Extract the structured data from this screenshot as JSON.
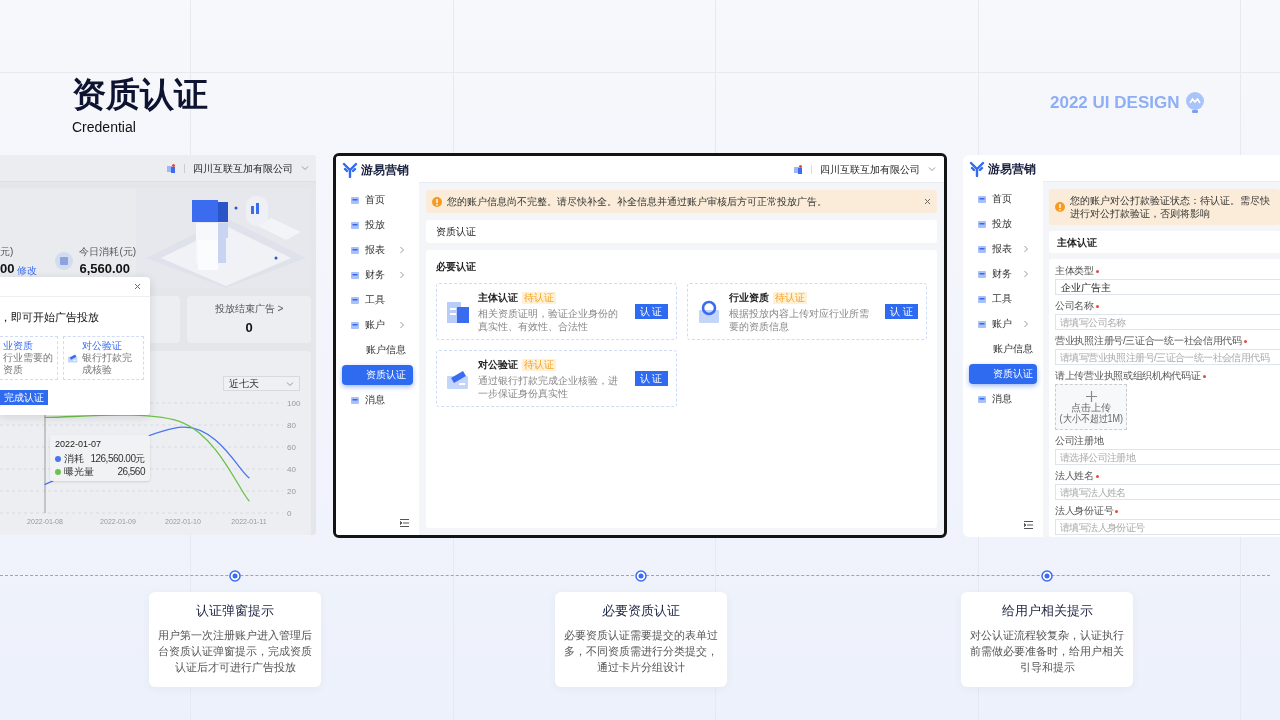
{
  "header": {
    "title": "资质认证",
    "subtitle": "Credential",
    "brand": "2022 UI DESIGN"
  },
  "left_panel": {
    "company": "四川互联互加有限公司",
    "balance_partial": {
      "label": "元)",
      "value": "00",
      "link": "修改"
    },
    "spend": {
      "label": "今日消耗(元)",
      "value": "6,560.00"
    },
    "summary_card": {
      "label": "投放结束广告 >",
      "value": "0"
    },
    "dialog": {
      "heading": "，即可开始广告投放",
      "button": "完成认证",
      "cards": [
        {
          "title": "业资质",
          "desc": "行业需要的资质"
        },
        {
          "kind": "bank",
          "title": "对公验证",
          "desc": "银行打款完成核验"
        }
      ]
    },
    "range_select": "近七天",
    "chart_data": {
      "type": "line",
      "grid": true,
      "ref_lines": [
        {
          "axis": "x",
          "value": "2022-01-08"
        }
      ],
      "categories": [
        "2022-01-08",
        "2022-01-09",
        "2022-01-10",
        "2022-01-11"
      ],
      "yticks": [
        0,
        20,
        40,
        60,
        80,
        100
      ],
      "ylim": [
        0,
        100
      ],
      "series": [
        {
          "name": "消耗",
          "color": "#4a74f0",
          "values": [
            26,
            null,
            78,
            32
          ]
        },
        {
          "name": "曝光量",
          "color": "#6cc24a",
          "values": [
            87,
            null,
            82,
            11
          ]
        }
      ]
    },
    "tooltip": {
      "date": "2022-01-07",
      "values": [
        "126,560.00元",
        "26,560"
      ]
    }
  },
  "center_panel": {
    "logo": "游易营销",
    "company": "四川互联互加有限公司",
    "nav": [
      {
        "label": "首页",
        "selected": false,
        "chevron": false
      },
      {
        "label": "投放",
        "selected": false,
        "chevron": false
      },
      {
        "label": "报表",
        "selected": false,
        "chevron": true
      },
      {
        "label": "财务",
        "selected": false,
        "chevron": true
      },
      {
        "label": "工具",
        "selected": false,
        "chevron": false
      },
      {
        "label": "账户",
        "selected": false,
        "chevron": true,
        "children": [
          {
            "label": "账户信息",
            "selected": false
          },
          {
            "label": "资质认证",
            "selected": true
          }
        ]
      },
      {
        "label": "消息",
        "selected": false,
        "chevron": false
      }
    ],
    "alert": "您的账户信息尚不完整。请尽快补全。补全信息并通过账户审核后方可正常投放广告。",
    "breadcrumb": "资质认证",
    "section": "必要认证",
    "cards": [
      {
        "kind": "entity",
        "title": "主体认证",
        "badge": "待认证",
        "desc": "相关资质证明，验证企业身份的真实性、有效性、合法性",
        "button": "认 证"
      },
      {
        "kind": "industry",
        "title": "行业资质",
        "badge": "待认证",
        "desc": "根据投放内容上传对应行业所需要的资质信息",
        "button": "认 证"
      },
      {
        "kind": "bank",
        "title": "对公验证",
        "badge": "待认证",
        "desc": "通过银行打款完成企业核验，进一步保证身份真实性",
        "button": "认 证"
      }
    ]
  },
  "right_panel": {
    "logo": "游易营销",
    "nav": [
      {
        "label": "首页",
        "selected": false,
        "chevron": false
      },
      {
        "label": "投放",
        "selected": false,
        "chevron": false
      },
      {
        "label": "报表",
        "selected": false,
        "chevron": true
      },
      {
        "label": "财务",
        "selected": false,
        "chevron": true
      },
      {
        "label": "工具",
        "selected": false,
        "chevron": false
      },
      {
        "label": "账户",
        "selected": false,
        "chevron": true,
        "children": [
          {
            "label": "账户信息",
            "selected": false
          },
          {
            "label": "资质认证",
            "selected": true
          }
        ]
      },
      {
        "label": "消息",
        "selected": false,
        "chevron": false
      }
    ],
    "alert": "您的账户对公打款验证状态：待认证。需尽快进行对公打款验证，否则将影响",
    "breadcrumb": "主体认证",
    "form": [
      {
        "kind": "select",
        "label": "主体类型",
        "required": true,
        "value": "企业广告主"
      },
      {
        "kind": "input",
        "label": "公司名称",
        "required": true,
        "placeholder": "请填写公司名称"
      },
      {
        "kind": "input",
        "label": "营业执照注册号/三证合一统一社会信用代码",
        "required": true,
        "placeholder": "请填写营业执照注册号/三证合一统一社会信用代码"
      },
      {
        "kind": "upload",
        "label": "请上传营业执照或组织机构代码证",
        "required": true,
        "upload_text": "点击上传",
        "upload_hint": "(大小不超过1M)"
      },
      {
        "kind": "input",
        "label": "公司注册地",
        "required": false,
        "placeholder": "请选择公司注册地"
      },
      {
        "kind": "input",
        "label": "法人姓名",
        "required": true,
        "placeholder": "请填写法人姓名"
      },
      {
        "kind": "input",
        "label": "法人身份证号",
        "required": true,
        "placeholder": "请填写法人身份证号"
      }
    ]
  },
  "steps": [
    {
      "title": "认证弹窗提示",
      "text": "用户第一次注册账户进入管理后台资质认证弹窗提示，完成资质认证后才可进行广告投放"
    },
    {
      "title": "必要资质认证",
      "text": "必要资质认证需要提交的表单过多，不同资质需进行分类提交，通过卡片分组设计"
    },
    {
      "title": "给用户相关提示",
      "text": "对公认证流程较复杂，认证执行前需做必要准备时，给用户相关引导和提示"
    }
  ]
}
